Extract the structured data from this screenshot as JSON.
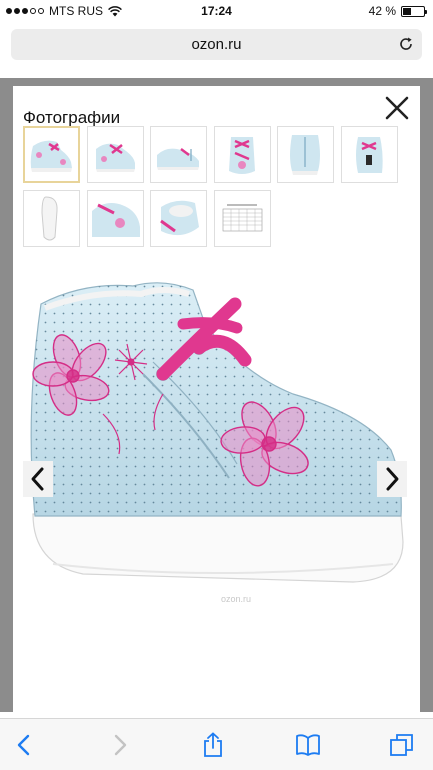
{
  "status_bar": {
    "carrier": "MTS RUS",
    "time": "17:24",
    "battery_text": "42 %",
    "battery_level": 0.42,
    "signal_bars_filled": 3,
    "signal_bars_total": 5
  },
  "browser": {
    "url": "ozon.ru"
  },
  "gallery": {
    "title": "Фотографии",
    "watermark": "ozon.ru",
    "thumbnail_count": 10,
    "selected_thumbnail": 1
  },
  "colors": {
    "shoe_blue": "#c9e4ef",
    "shoe_pink": "#e0388f",
    "ios_blue": "#1d7cf2",
    "selected_border": "#e8d49a"
  },
  "icons": {
    "close": "close-icon",
    "prev": "chevron-left-icon",
    "next": "chevron-right-icon",
    "reload": "reload-icon",
    "back": "back-icon",
    "forward": "forward-icon",
    "share": "share-icon",
    "bookmarks": "bookmarks-icon",
    "tabs": "tabs-icon"
  }
}
